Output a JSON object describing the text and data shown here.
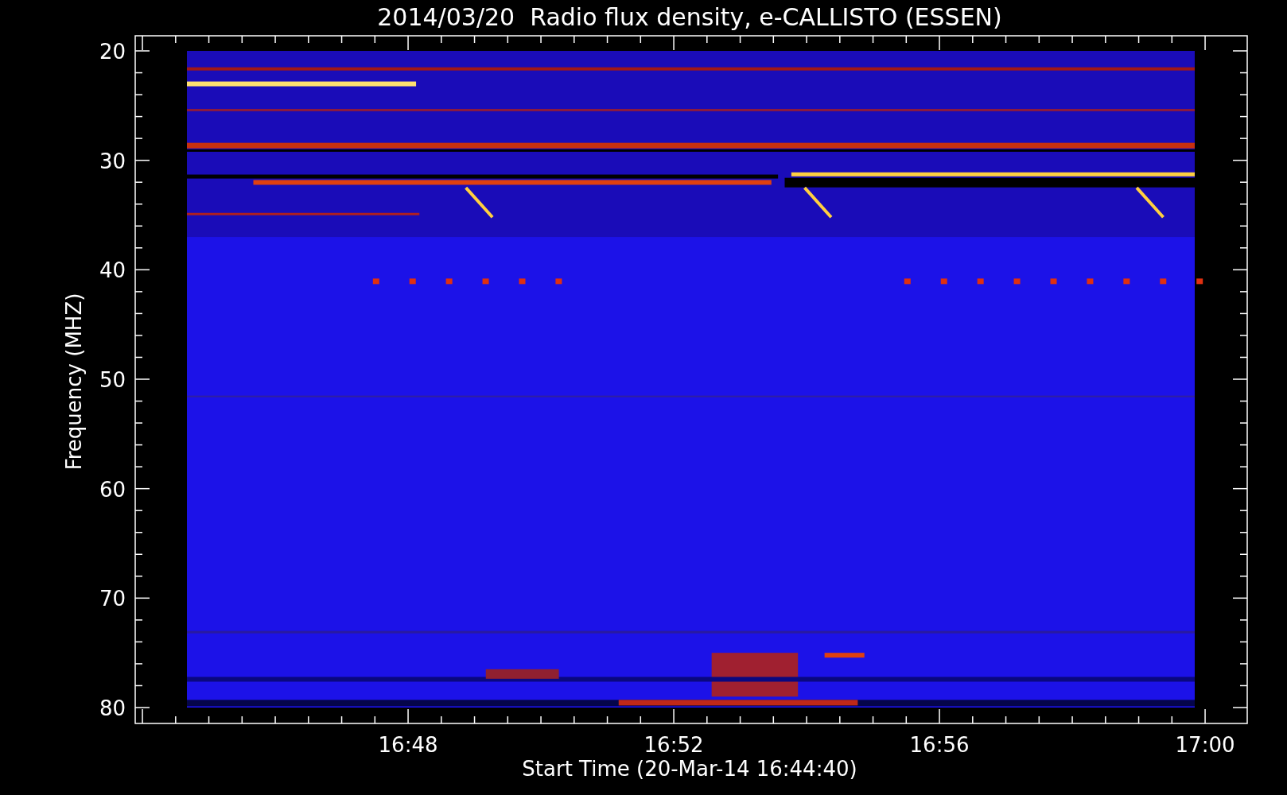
{
  "title": "2014/03/20  Radio flux density, e-CALLISTO (ESSEN)",
  "y_axis": {
    "label": "Frequency (MHZ)",
    "ticks": [
      "20",
      "30",
      "40",
      "50",
      "60",
      "70",
      "80"
    ]
  },
  "x_axis": {
    "label": "Start Time (20-Mar-14 16:44:40)",
    "ticks": [
      "16:48",
      "16:52",
      "16:56",
      "17:00"
    ]
  }
}
